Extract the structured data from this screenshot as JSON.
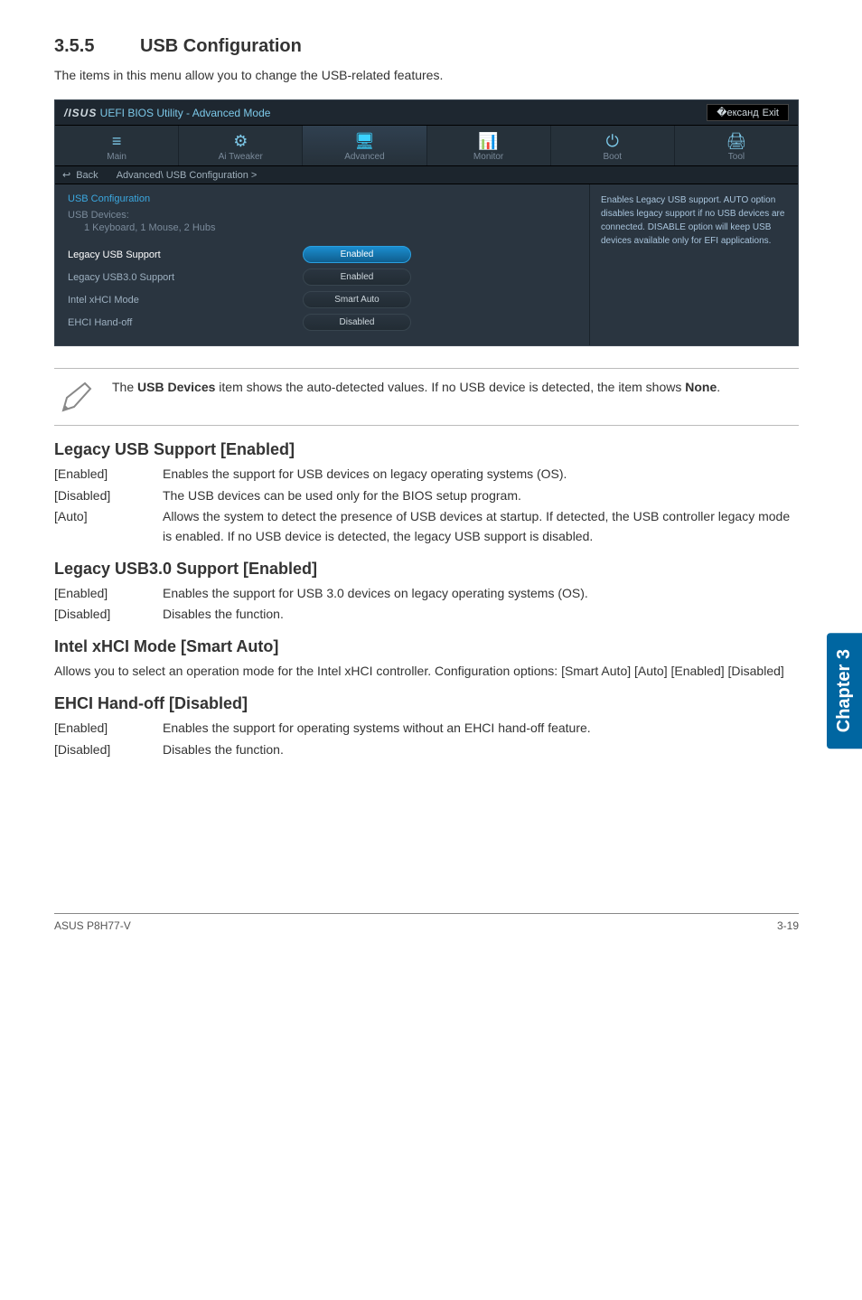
{
  "section": {
    "number": "3.5.5",
    "title": "USB Configuration"
  },
  "intro": "The items in this menu allow you to change the USB-related features.",
  "bios": {
    "brand": "/ISUS",
    "title_rest": " UEFI BIOS Utility - Advanced Mode",
    "exit_label": "Exit",
    "nav": [
      {
        "icon": "≡",
        "label": "Main"
      },
      {
        "icon": "⚙",
        "label": "Ai Tweaker"
      },
      {
        "icon": "🖥",
        "label": "Advanced",
        "active": true
      },
      {
        "icon": "📊",
        "label": "Monitor"
      },
      {
        "icon": "⏻",
        "label": "Boot"
      },
      {
        "icon": "🖨",
        "label": "Tool"
      }
    ],
    "breadcrumb": {
      "back": "Back",
      "path": "Advanced\\ USB Configuration >"
    },
    "main": {
      "heading": "USB Configuration",
      "sub1": "USB Devices:",
      "sub2": "1 Keyboard, 1 Mouse, 2 Hubs",
      "rows": [
        {
          "label": "Legacy USB Support",
          "value": "Enabled",
          "highlight": true
        },
        {
          "label": "Legacy USB3.0 Support",
          "value": "Enabled"
        },
        {
          "label": "Intel xHCI Mode",
          "value": "Smart Auto"
        },
        {
          "label": "EHCI Hand-off",
          "value": "Disabled"
        }
      ]
    },
    "help": "Enables Legacy USB support. AUTO option disables legacy support if no USB devices are connected. DISABLE option will keep USB devices available only for EFI applications."
  },
  "note": {
    "text_pre": "The ",
    "bold1": "USB Devices",
    "text_mid": " item shows the auto-detected values. If no USB device is detected, the item shows ",
    "bold2": "None",
    "text_post": "."
  },
  "settings": [
    {
      "title": "Legacy USB Support [Enabled]",
      "options": [
        {
          "key": "[Enabled]",
          "val": "Enables the support for USB devices on legacy operating systems (OS)."
        },
        {
          "key": "[Disabled]",
          "val": "The USB devices can be used only for the BIOS setup program."
        },
        {
          "key": "[Auto]",
          "val": "Allows the system to detect the presence of USB devices at startup. If detected, the USB controller legacy mode is enabled. If no USB device is detected, the legacy USB support is disabled."
        }
      ]
    },
    {
      "title": "Legacy USB3.0 Support [Enabled]",
      "options": [
        {
          "key": "[Enabled]",
          "val": "Enables the support for USB 3.0 devices on legacy operating systems (OS)."
        },
        {
          "key": "[Disabled]",
          "val": "Disables the function."
        }
      ]
    },
    {
      "title": "Intel xHCI Mode [Smart Auto]",
      "para": "Allows you to select an operation mode for the Intel xHCI controller. Configuration options: [Smart Auto] [Auto] [Enabled] [Disabled]"
    },
    {
      "title": "EHCI Hand-off [Disabled]",
      "options": [
        {
          "key": "[Enabled]",
          "val": "Enables the support for operating systems without an EHCI hand-off feature."
        },
        {
          "key": "[Disabled]",
          "val": "Disables the function."
        }
      ]
    }
  ],
  "chapter_tab": "Chapter 3",
  "footer": {
    "left": "ASUS P8H77-V",
    "right": "3-19"
  }
}
